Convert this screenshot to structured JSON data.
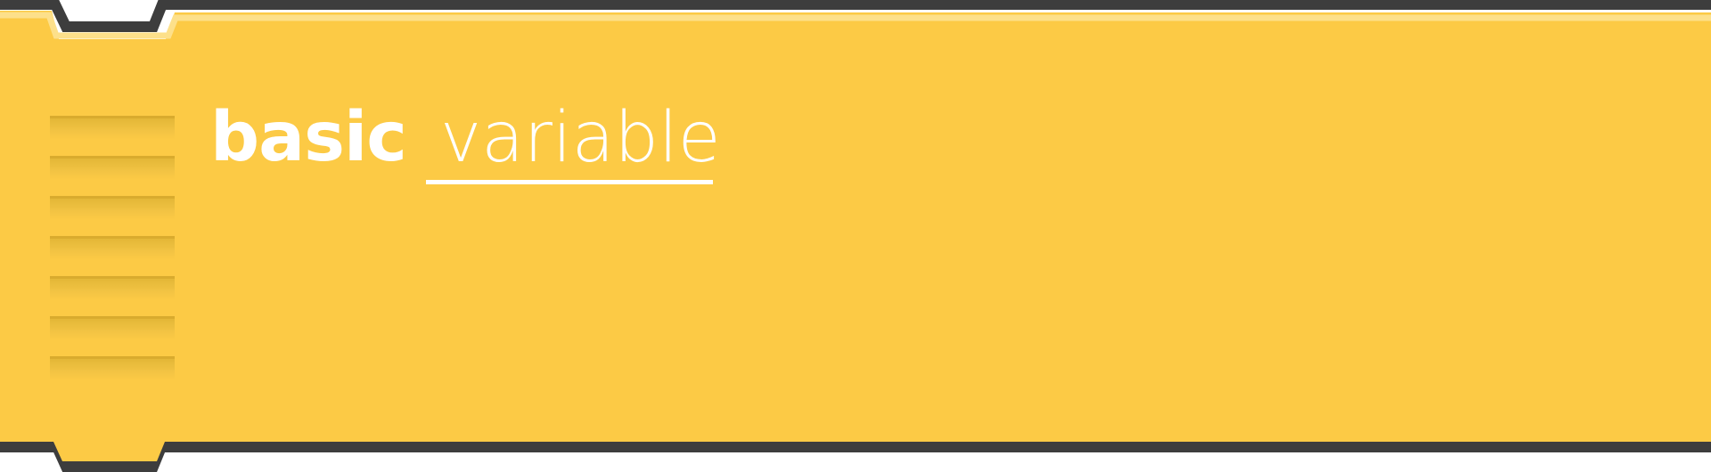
{
  "block": {
    "keyword": "basic",
    "variable_name": "variable",
    "colors": {
      "fill": "#fcca45",
      "highlight": "#fde08a",
      "outline": "#3d3d3d",
      "grip_shadow": "#d9ab2e",
      "text": "#ffffff"
    }
  }
}
